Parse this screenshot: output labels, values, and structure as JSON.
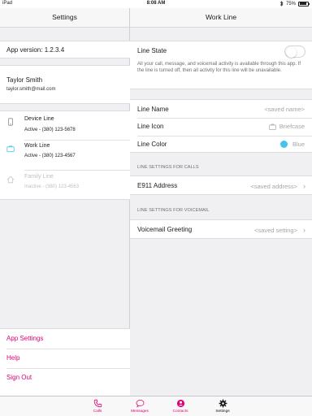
{
  "status_bar": {
    "carrier": "iPad",
    "time": "8:08 AM",
    "battery": "75%",
    "battery_level": 0.75
  },
  "left": {
    "title": "Settings",
    "app_version": "App version: 1.2.3.4",
    "user": {
      "name": "Taylor Smith",
      "email": "taylor.smith@mail.com"
    },
    "lines": [
      {
        "name": "Device Line",
        "status": "Active - (380) 123-5678",
        "icon": "device-line-icon",
        "enabled": true
      },
      {
        "name": "Work Line",
        "status": "Active - (380) 123-4567",
        "icon": "work-line-icon",
        "enabled": true
      },
      {
        "name": "Family Line",
        "status": "Inactive - (380) 123-4563",
        "icon": "family-line-icon",
        "enabled": false
      }
    ],
    "links": [
      "App Settings",
      "Help",
      "Sign Out"
    ]
  },
  "right": {
    "title": "Work Line",
    "line_state": {
      "label": "Line State",
      "on": false,
      "description": "All your call, message, and voicemail activity is available through this app. If the line is turned off, then all activity for this line will be unavailable."
    },
    "line_name": {
      "label": "Line Name",
      "value": "<saved name>"
    },
    "line_icon": {
      "label": "Line Icon",
      "value": "Briefcase",
      "icon": "briefcase-icon"
    },
    "line_color": {
      "label": "Line Color",
      "value": "Blue",
      "swatch": "#43c3ee"
    },
    "calls_section": "LINE SETTINGS FOR CALLS",
    "e911": {
      "label": "E911 Address",
      "value": "<saved address>"
    },
    "voicemail_section": "LINE SETTINGS FOR VOICEMAIL",
    "voicemail_greeting": {
      "label": "Voicemail Greeting",
      "value": "<saved setting>"
    }
  },
  "tabs": [
    {
      "label": "Calls",
      "icon": "phone-icon"
    },
    {
      "label": "Messages",
      "icon": "chat-bubble-icon"
    },
    {
      "label": "Contacts",
      "icon": "contact-icon"
    },
    {
      "label": "Settings",
      "icon": "gear-icon",
      "active": true
    }
  ],
  "colors": {
    "accent": "#e20074",
    "pane_background": "#f0f0f2",
    "secondary_text": "#a6a6ab"
  }
}
